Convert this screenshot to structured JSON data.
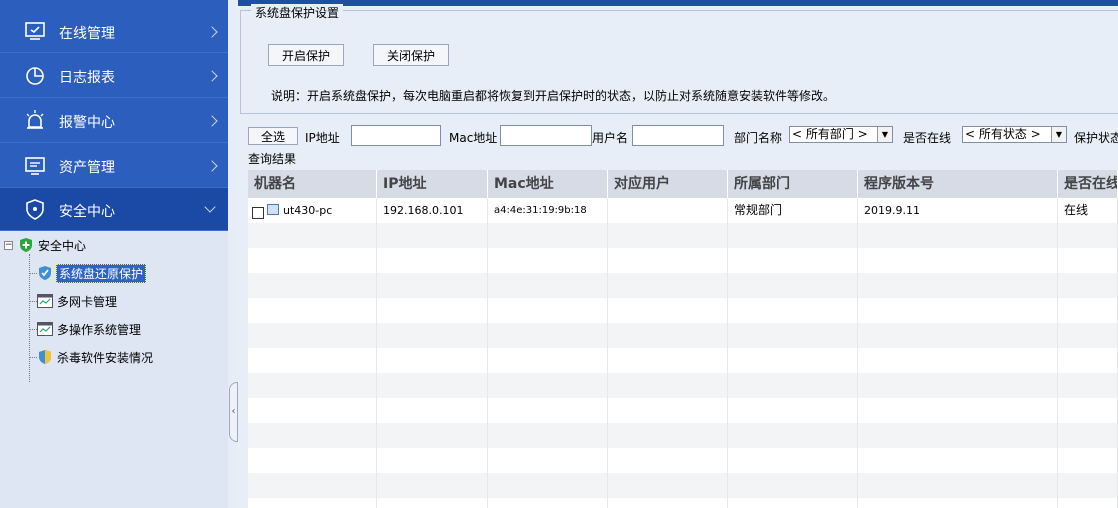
{
  "sidebar": {
    "nav": [
      {
        "label": "在线管理",
        "icon": "monitor-icon"
      },
      {
        "label": "日志报表",
        "icon": "pie-chart-icon"
      },
      {
        "label": "报警中心",
        "icon": "alarm-icon"
      },
      {
        "label": "资产管理",
        "icon": "asset-icon"
      },
      {
        "label": "安全中心",
        "icon": "shield-icon"
      }
    ],
    "tree": {
      "root": "安全中心",
      "children": [
        {
          "label": "系统盘还原保护",
          "icon": "shield-check-icon"
        },
        {
          "label": "多网卡管理",
          "icon": "window-icon"
        },
        {
          "label": "多操作系统管理",
          "icon": "window-icon"
        },
        {
          "label": "杀毒软件安装情况",
          "icon": "shield-check-icon"
        }
      ]
    }
  },
  "protection": {
    "legend": "系统盘保护设置",
    "enable_label": "开启保护",
    "disable_label": "关闭保护",
    "description": "说明：开启系统盘保护，每次电脑重启都将恢复到开启保护时的状态，以防止对系统随意安装软件等修改。"
  },
  "filter": {
    "select_all": "全选",
    "ip_label": "IP地址",
    "mac_label": "Mac地址",
    "user_label": "用户名",
    "dept_label": "部门名称",
    "dept_value": "< 所有部门 >",
    "online_label": "是否在线",
    "online_value": "< 所有状态 >",
    "protect_label": "保护状态"
  },
  "results": {
    "legend": "查询结果",
    "columns": [
      "机器名",
      "IP地址",
      "Mac地址",
      "对应用户",
      "所属部门",
      "程序版本号",
      "是否在线"
    ],
    "rows": [
      {
        "name": "ut430-pc",
        "ip": "192.168.0.101",
        "mac": "a4:4e:31:19:9b:18",
        "user": "",
        "dept": "常规部门",
        "version": "2019.9.11",
        "online": "在线"
      }
    ]
  }
}
